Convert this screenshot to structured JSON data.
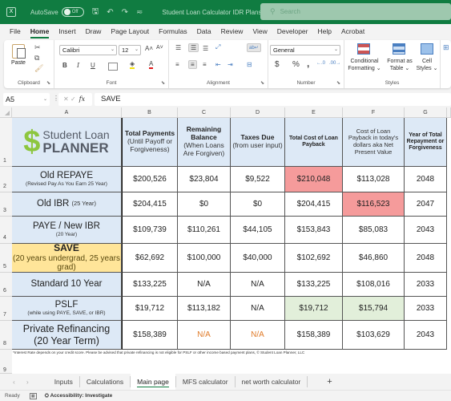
{
  "titlebar": {
    "app_icon": "excel-icon",
    "autosave_label": "AutoSave",
    "autosave_state": "Off",
    "doc_title": "Student Loan Calculator IDR Plans",
    "search_placeholder": "Search"
  },
  "menu": [
    "File",
    "Home",
    "Insert",
    "Draw",
    "Page Layout",
    "Formulas",
    "Data",
    "Review",
    "View",
    "Developer",
    "Help",
    "Acrobat"
  ],
  "menu_active": "Home",
  "ribbon": {
    "clipboard": {
      "paste": "Paste",
      "label": "Clipboard"
    },
    "font": {
      "name": "Calibri",
      "size": "12",
      "label": "Font",
      "bold": "B",
      "italic": "I",
      "underline": "U"
    },
    "alignment": {
      "label": "Alignment"
    },
    "number": {
      "format": "General",
      "label": "Number",
      "currency": "$",
      "percent": "%",
      "comma": ","
    },
    "styles": {
      "label": "Styles",
      "conditional": [
        "Conditional",
        "Formatting"
      ],
      "format_table": [
        "Format as",
        "Table"
      ],
      "cell_styles": [
        "Cell",
        "Styles"
      ]
    }
  },
  "formula_bar": {
    "name_box": "A5",
    "formula": "SAVE",
    "fx": "fx"
  },
  "columns": [
    "A",
    "B",
    "C",
    "D",
    "E",
    "F",
    "G"
  ],
  "rows": [
    "1",
    "2",
    "3",
    "4",
    "5",
    "6",
    "7",
    "8",
    "9"
  ],
  "logo": {
    "line1": "Student Loan",
    "line2": "PLANNER",
    "symbol": "$",
    "color": "#8dc63f",
    "text_color": "#555b66"
  },
  "headers": {
    "B": {
      "bold": "Total Payments",
      "normal": "(Until Payoff or Forgiveness)"
    },
    "C": {
      "bold": "Remaining Balance",
      "normal": "(When Loans Are Forgiven)"
    },
    "D": {
      "bold": "Taxes Due",
      "normal": "(from user input)"
    },
    "E": {
      "bold": "Total Cost of Loan Payback",
      "normal": ""
    },
    "F": {
      "bold": "",
      "normal": "Cost of Loan Payback in today's dollars aka Net Present Value"
    },
    "G": {
      "bold": "Year of Total Repayment or Forgiveness",
      "normal": ""
    }
  },
  "plans": [
    {
      "name": "Old REPAYE",
      "sub": "(Revised Pay As You Earn 25 Year)",
      "total_payments": "$200,526",
      "remaining_balance": "$23,804",
      "taxes_due": "$9,522",
      "total_cost": "$210,048",
      "npv": "$113,028",
      "year": "2048"
    },
    {
      "name": "Old IBR",
      "sub_inline": "(25 Year)",
      "total_payments": "$204,415",
      "remaining_balance": "$0",
      "taxes_due": "$0",
      "total_cost": "$204,415",
      "npv": "$116,523",
      "year": "2047"
    },
    {
      "name": "PAYE / New IBR",
      "sub": "(20 Year)",
      "total_payments": "$109,739",
      "remaining_balance": "$110,261",
      "taxes_due": "$44,105",
      "total_cost": "$153,843",
      "npv": "$85,083",
      "year": "2043"
    },
    {
      "name": "SAVE",
      "sub": "(20 years undergrad, 25 years grad)",
      "total_payments": "$62,692",
      "remaining_balance": "$100,000",
      "taxes_due": "$40,000",
      "total_cost": "$102,692",
      "npv": "$46,860",
      "year": "2048"
    },
    {
      "name": "Standard 10 Year",
      "sub": "",
      "total_payments": "$133,225",
      "remaining_balance": "N/A",
      "taxes_due": "N/A",
      "total_cost": "$133,225",
      "npv": "$108,016",
      "year": "2033"
    },
    {
      "name": "PSLF",
      "sub": "(while using PAYE, SAVE, or IBR)",
      "total_payments": "$19,712",
      "remaining_balance": "$113,182",
      "taxes_due": "N/A",
      "total_cost": "$19,712",
      "npv": "$15,794",
      "year": "2033"
    },
    {
      "name": "Private Refinancing",
      "name2": "(20 Year Term)",
      "total_payments": "$158,389",
      "remaining_balance": "N/A",
      "taxes_due": "N/A",
      "total_cost": "$158,389",
      "npv": "$103,629",
      "year": "2043"
    }
  ],
  "highlight_colors": {
    "red": "#f59b9b",
    "green": "#e2efda",
    "save": "#ffe599",
    "header": "#dde9f6",
    "na_orange": "#e07b29"
  },
  "footnote": "*Interest Rate depends on your credit score. Please be advised that private refinancing is not eligible for PSLF or other income based payment plans, © Student Loan Planner, LLC",
  "sheet_tabs": [
    "Inputs",
    "Calculations",
    "Main page",
    "MFS calculator",
    "net worth calculator"
  ],
  "active_sheet": "Main page",
  "add_sheet": "+",
  "status": {
    "ready": "Ready",
    "accessibility": "Accessibility: Investigate"
  }
}
